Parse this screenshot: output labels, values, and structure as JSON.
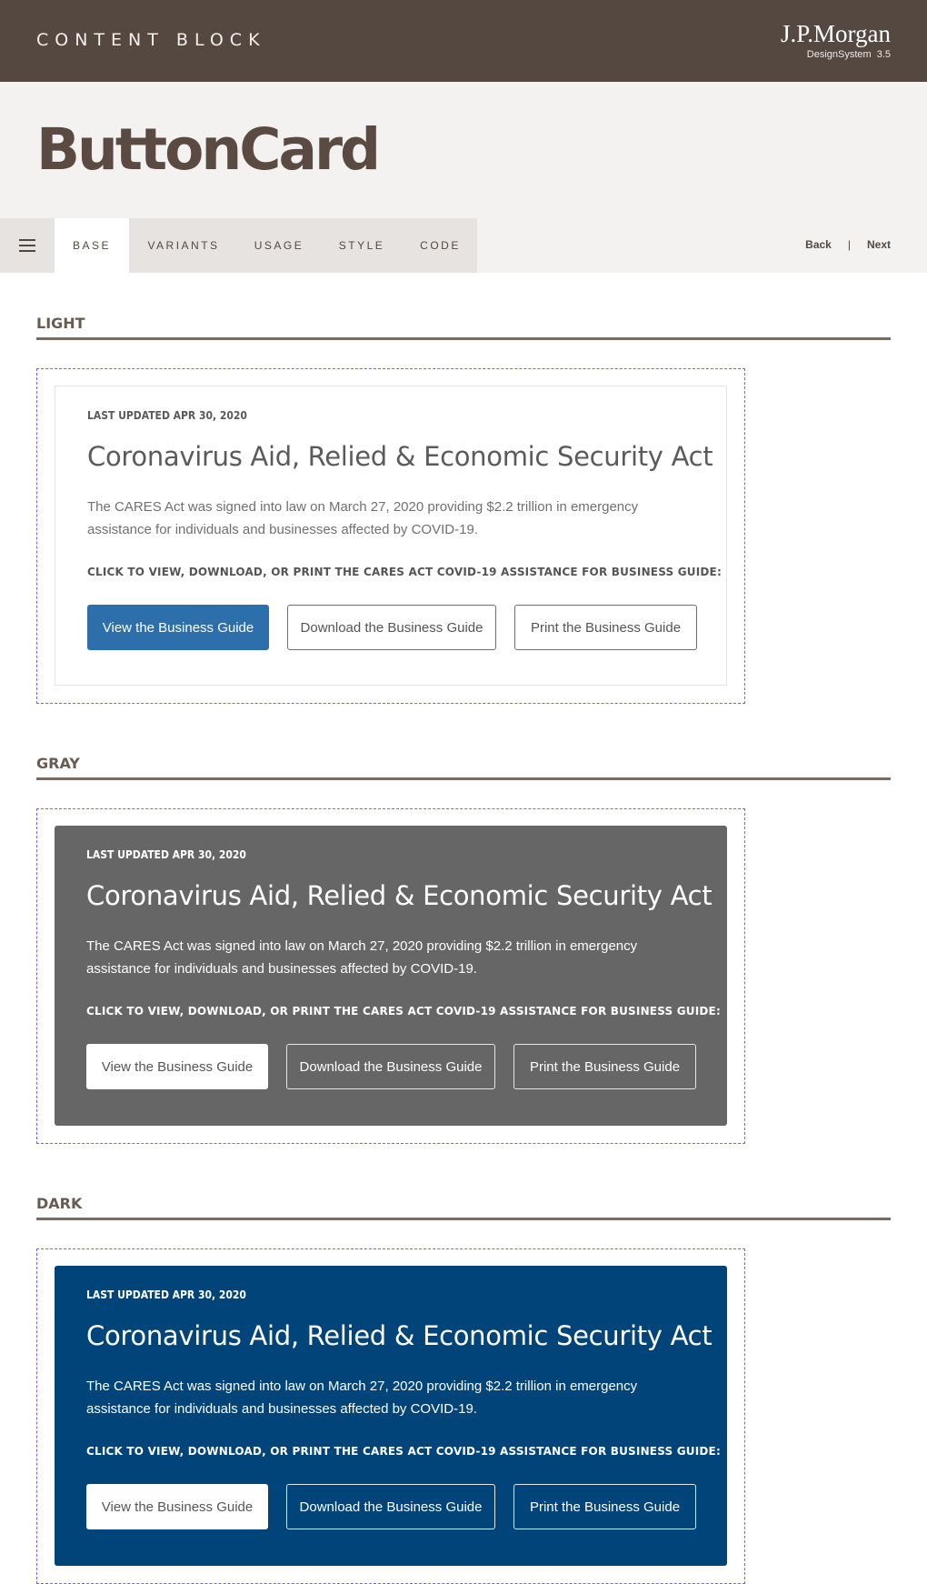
{
  "header": {
    "section": "CONTENT BLOCK",
    "brand_logo": "J.P.Morgan",
    "brand_sub": "DesignSystem",
    "brand_version": "3.5"
  },
  "page_title": "ButtonCard",
  "nav": {
    "tabs": [
      "BASE",
      "VARIANTS",
      "USAGE",
      "STYLE",
      "CODE"
    ],
    "active_tab": "BASE",
    "back": "Back",
    "separator": "|",
    "next": "Next"
  },
  "sections": [
    {
      "label": "LIGHT",
      "card": {
        "updated": "LAST UPDATED APR 30, 2020",
        "title": "Coronavirus Aid, Relied & Economic Security Act",
        "description": "The CARES Act was signed into law on March 27, 2020 providing $2.2 trillion in emergency assistance for individuals and businesses affected by COVID-19.",
        "cta": "CLICK TO VIEW, DOWNLOAD, OR PRINT THE CARES ACT COVID-19 ASSISTANCE FOR BUSINESS GUIDE:",
        "buttons": [
          "View the Business Guide",
          "Download the Business Guide",
          "Print the Business Guide"
        ]
      }
    },
    {
      "label": "GRAY",
      "card": {
        "updated": "LAST UPDATED APR 30, 2020",
        "title": "Coronavirus Aid, Relied & Economic Security Act",
        "description": "The CARES Act was signed into law on March 27, 2020 providing $2.2 trillion in emergency assistance for individuals and businesses affected by COVID-19.",
        "cta": "CLICK TO VIEW, DOWNLOAD, OR PRINT THE CARES ACT COVID-19 ASSISTANCE FOR BUSINESS GUIDE:",
        "buttons": [
          "View the Business Guide",
          "Download the Business Guide",
          "Print the Business Guide"
        ]
      }
    },
    {
      "label": "DARK",
      "card": {
        "updated": "LAST UPDATED APR 30, 2020",
        "title": "Coronavirus Aid, Relied & Economic Security Act",
        "description": "The CARES Act was signed into law on March 27, 2020 providing $2.2 trillion in emergency assistance for individuals and businesses affected by COVID-19.",
        "cta": "CLICK TO VIEW, DOWNLOAD, OR PRINT THE CARES ACT COVID-19 ASSISTANCE FOR BUSINESS GUIDE:",
        "buttons": [
          "View the Business Guide",
          "Download the Business Guide",
          "Print the Business Guide"
        ]
      }
    }
  ],
  "colors": {
    "header_bg": "#544840",
    "title_color": "#5a4a42",
    "primary_button": "#2d6fab",
    "gray_card": "#666666",
    "dark_card": "#01447a",
    "frame_dash": "#7b61ff"
  }
}
